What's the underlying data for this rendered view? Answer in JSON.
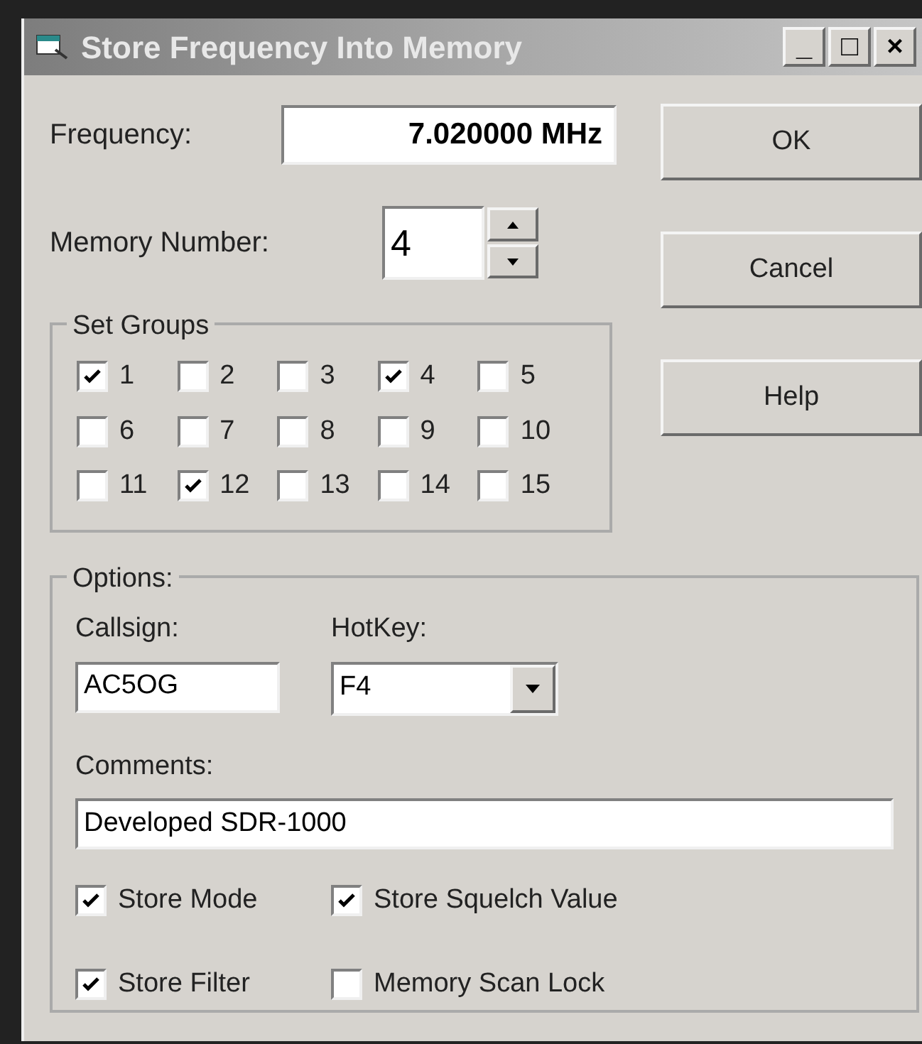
{
  "window": {
    "title": "Store Frequency Into Memory",
    "controls": [
      "_",
      "□",
      "×"
    ]
  },
  "frequency": {
    "label": "Frequency:",
    "value": "7.020000 MHz"
  },
  "memory_number": {
    "label": "Memory Number:",
    "value": "4"
  },
  "buttons": [
    "OK",
    "Cancel",
    "Help"
  ],
  "set_groups": {
    "title": "Set Groups",
    "items": [
      {
        "label": "1",
        "checked": true
      },
      {
        "label": "2",
        "checked": false
      },
      {
        "label": "3",
        "checked": false
      },
      {
        "label": "4",
        "checked": true
      },
      {
        "label": "5",
        "checked": false
      },
      {
        "label": "6",
        "checked": false
      },
      {
        "label": "7",
        "checked": false
      },
      {
        "label": "8",
        "checked": false
      },
      {
        "label": "9",
        "checked": false
      },
      {
        "label": "10",
        "checked": false
      },
      {
        "label": "11",
        "checked": false
      },
      {
        "label": "12",
        "checked": true
      },
      {
        "label": "13",
        "checked": false
      },
      {
        "label": "14",
        "checked": false
      },
      {
        "label": "15",
        "checked": false
      }
    ]
  },
  "options": {
    "title": "Options:",
    "callsign": {
      "label": "Callsign:",
      "value": "AC5OG"
    },
    "hotkey": {
      "label": "HotKey:",
      "value": "F4"
    },
    "comments": {
      "label": "Comments:",
      "value": "Developed SDR-1000"
    },
    "checkboxes": [
      {
        "label": "Store Mode",
        "checked": true
      },
      {
        "label": "Store Squelch Value",
        "checked": true
      },
      {
        "label": "Store Filter",
        "checked": true
      },
      {
        "label": "Memory Scan Lock",
        "checked": false
      }
    ]
  }
}
